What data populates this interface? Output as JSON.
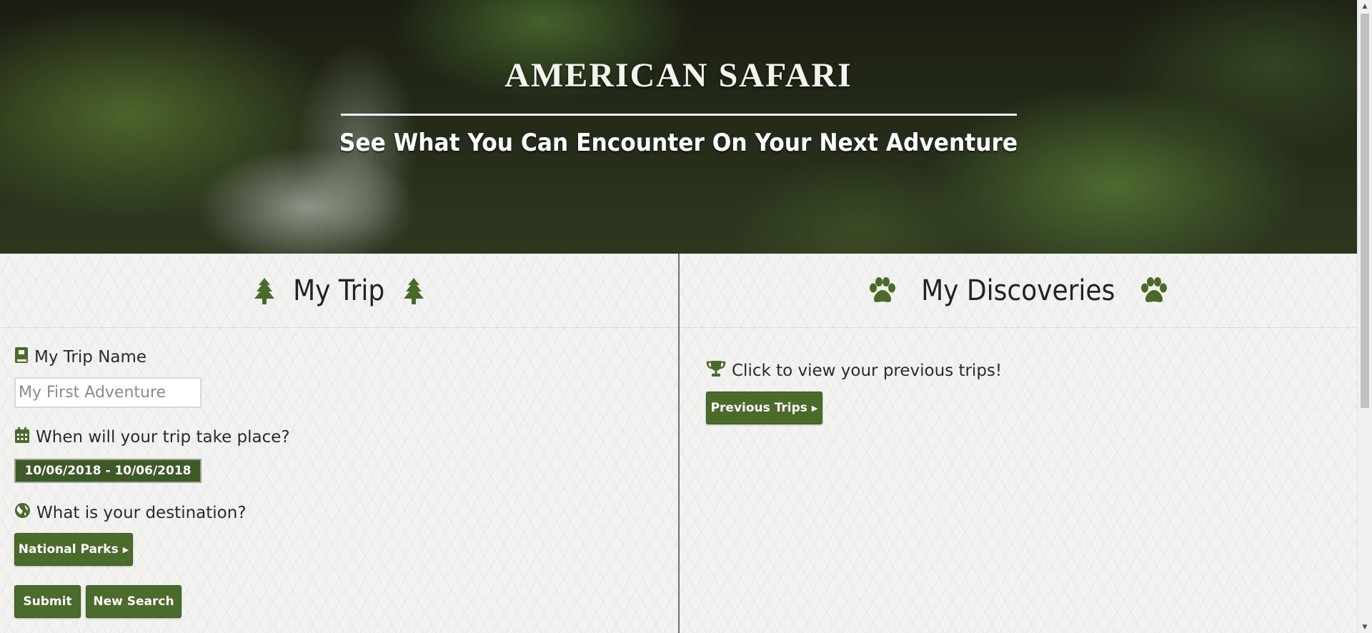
{
  "hero": {
    "title": "AMERICAN SAFARI",
    "subtitle": "See What You Can Encounter On Your Next Adventure"
  },
  "trip_panel": {
    "title": "My Trip",
    "header_icon": "tree-icon",
    "trip_name": {
      "label": "My Trip Name",
      "icon": "journal-icon",
      "placeholder": "My First Adventure",
      "value": ""
    },
    "dates": {
      "label": "When will your trip take place?",
      "icon": "calendar-icon",
      "value": "10/06/2018 - 10/06/2018"
    },
    "destination": {
      "label": "What is your destination?",
      "icon": "globe-icon",
      "button_label": "National Parks"
    },
    "submit_label": "Submit",
    "new_search_label": "New Search"
  },
  "discoveries_panel": {
    "title": "My Discoveries",
    "header_icon": "paw-icon",
    "prompt": {
      "label": "Click to view your previous trips!",
      "icon": "trophy-icon"
    },
    "previous_trips_label": "Previous Trips"
  },
  "colors": {
    "accent_green": "#4b6b2b",
    "date_button": "#3e5a26",
    "panel_bg": "#f2f2f0",
    "title_text": "#232323"
  }
}
